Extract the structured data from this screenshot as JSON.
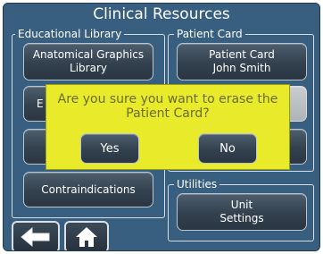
{
  "header": {
    "title": "Clinical Resources"
  },
  "educational_library": {
    "title": "Educational Library",
    "anatomical_graphics": {
      "line1": "Anatomical Graphics",
      "line2": "Library"
    },
    "btn2_partial": "E",
    "contraindications": "Contraindications"
  },
  "patient_card": {
    "title": "Patient Card",
    "patient_card_button": {
      "line1": "Patient Card",
      "line2": "John Smith"
    }
  },
  "utilities": {
    "title": "Utilities",
    "unit_settings": {
      "line1": "Unit",
      "line2": "Settings"
    }
  },
  "nav": {
    "back_icon": "arrow-left-icon",
    "home_icon": "home-icon"
  },
  "dialog": {
    "message_line1": "Are you sure you want to erase the",
    "message_line2": "Patient Card?",
    "yes_label": "Yes",
    "no_label": "No"
  },
  "colors": {
    "background": "#395f80",
    "dialog": "#e8ea2a",
    "button": "#33414f",
    "text": "#ffffff"
  }
}
